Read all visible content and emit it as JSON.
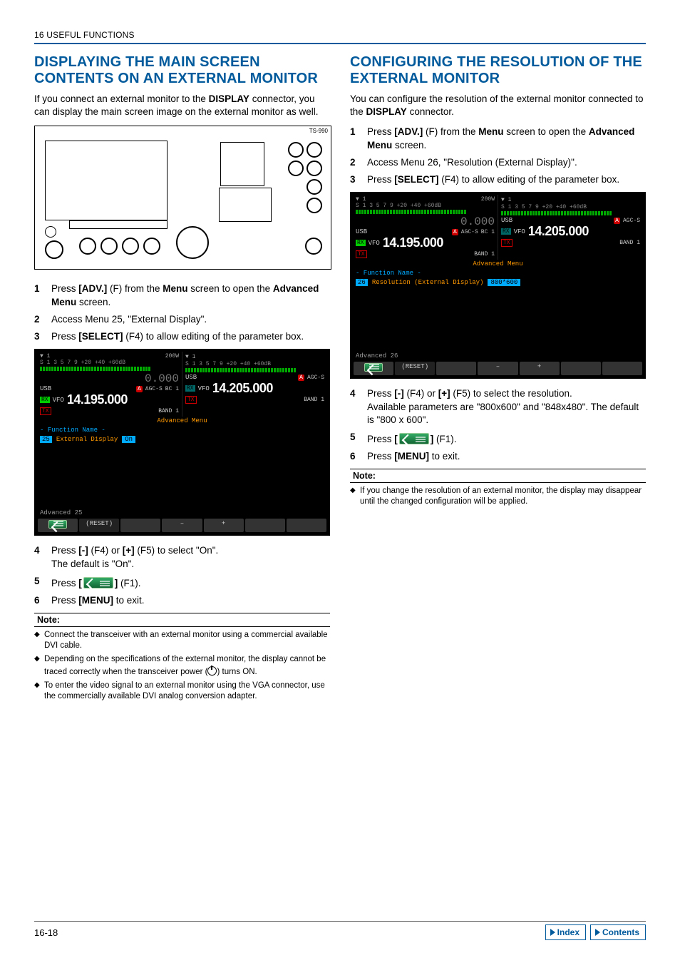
{
  "header": {
    "chapter": "16 USEFUL FUNCTIONS"
  },
  "left": {
    "title": "DISPLAYING THE MAIN SCREEN CONTENTS ON AN EXTERNAL MONITOR",
    "intro_pre": "If you connect an external monitor to the ",
    "intro_bold": "DISPLAY",
    "intro_post": " connector, you can display the main screen image on the external monitor as well.",
    "diagram_label": "TS-990",
    "steps": {
      "s1_a": "Press ",
      "s1_b": "[ADV.]",
      "s1_c": " (F) from the ",
      "s1_d": "Menu",
      "s1_e": " screen to open the ",
      "s1_f": "Advanced Menu",
      "s1_g": " screen.",
      "s2": "Access Menu 25, \"External Display\".",
      "s3_a": "Press ",
      "s3_b": "[SELECT]",
      "s3_c": " (F4) to allow editing of the parameter box.",
      "s4_a": "Press ",
      "s4_b": "[-]",
      "s4_c": " (F4) or ",
      "s4_d": "[+]",
      "s4_e": " (F5) to select \"On\".",
      "s4_sub": "The default is \"On\".",
      "s5_a": "Press ",
      "s5_b": "[",
      "s5_c": "]",
      "s5_d": " (F1).",
      "s6_a": "Press ",
      "s6_b": "[MENU]",
      "s6_c": " to exit."
    },
    "note_title": "Note:",
    "notes": {
      "n1": "Connect the transceiver with an external monitor using a commercial available DVI cable.",
      "n2_a": "Depending on the specifications of the external monitor, the display cannot be traced correctly when the transceiver power (",
      "n2_b": ") turns ON.",
      "n3": "To enter the video signal to an external monitor using the VGA connector, use the commercially available DVI analog conversion adapter."
    },
    "menushot": {
      "ant_left": "▼ 1",
      "ant_right": "▼ 1",
      "s_scale": "S  1   3   5   7   9      +20    +40 +60dB",
      "usb": "USB",
      "rx": "RX",
      "tx": "TX",
      "vfo": "VFO",
      "freq_main": "14.195.000",
      "freq_sub": "14.205.000",
      "sub_zero": "0.000",
      "pwr": "200W",
      "att": "A",
      "agc": "AGC-S",
      "bc": "BC 1",
      "band": "BAND 1",
      "strip": "Advanced  Menu",
      "func_header": "-  Function Name  -",
      "idx": "25",
      "item": "External Display",
      "value": "On",
      "bottom": "Advanced 25",
      "btn_reset": "(RESET)",
      "btn_minus": "–",
      "btn_plus": "+"
    }
  },
  "right": {
    "title": "CONFIGURING THE RESOLUTION OF THE EXTERNAL MONITOR",
    "intro_pre": "You can configure the resolution of the external monitor connected to the ",
    "intro_bold": "DISPLAY",
    "intro_post": " connector.",
    "steps": {
      "s1_a": "Press ",
      "s1_b": "[ADV.]",
      "s1_c": " (F) from the ",
      "s1_d": "Menu",
      "s1_e": " screen to open the ",
      "s1_f": "Advanced Menu",
      "s1_g": " screen.",
      "s2": "Access Menu 26, \"Resolution (External Display)\".",
      "s3_a": "Press ",
      "s3_b": "[SELECT]",
      "s3_c": " (F4) to allow editing of the parameter box.",
      "s4_a": "Press ",
      "s4_b": "[-]",
      "s4_c": " (F4) or ",
      "s4_d": "[+]",
      "s4_e": " (F5) to select the resolution.",
      "s4_sub": "Available parameters are \"800x600\" and \"848x480\". The default is \"800 x 600\".",
      "s5_a": "Press ",
      "s5_b": "[",
      "s5_c": "]",
      "s5_d": " (F1).",
      "s6_a": "Press ",
      "s6_b": "[MENU]",
      "s6_c": " to exit."
    },
    "note_title": "Note:",
    "notes": {
      "n1": "If you change the resolution of an external monitor, the display may disappear until the changed configuration will be applied."
    },
    "menushot": {
      "idx": "26",
      "item": "Resolution (External Display)",
      "value": "800*600",
      "bottom": "Advanced 26"
    }
  },
  "footer": {
    "page": "16-18",
    "index": "Index",
    "contents": "Contents"
  }
}
